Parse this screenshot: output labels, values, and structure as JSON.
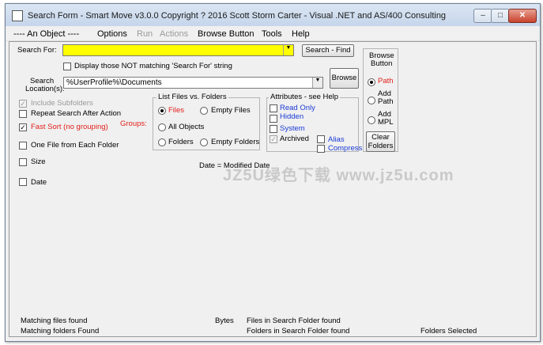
{
  "window": {
    "title": "Search Form - Smart Move v3.0.0 Copyright ? 2016 Scott Storm Carter - Visual .NET and AS/400 Consulting",
    "buttons": {
      "minimize": "–",
      "maximize": "□",
      "close": "✕"
    }
  },
  "menu": {
    "items": [
      "---- An Object ----",
      "Options",
      "Run",
      "Actions",
      "Browse Button",
      "Tools",
      "Help"
    ]
  },
  "search": {
    "search_for_label": "Search For:",
    "search_for_value": "",
    "find_button": "Search - Find",
    "display_not_matching": "Display those NOT matching 'Search For' string",
    "location_label_1": "Search",
    "location_label_2": "Location(s):",
    "location_value": "%UserProfile%\\Documents",
    "browse_button": "Browse"
  },
  "browse_group": {
    "title_1": "Browse",
    "title_2": "Button",
    "options": [
      "Path",
      "Add Path",
      "Add MPL"
    ],
    "clear_button": "Clear Folders"
  },
  "left_options": {
    "include_subfolders": "Include Subfolders",
    "repeat_search": "Repeat Search After Action",
    "fast_sort": "Fast Sort (no grouping)",
    "groups": "Groups:",
    "one_file": "One File from Each Folder",
    "size": "Size",
    "date": "Date"
  },
  "list_group": {
    "title": "List Files vs. Folders",
    "files": "Files",
    "empty_files": "Empty Files",
    "all_objects": "All Objects",
    "folders": "Folders",
    "empty_folders": "Empty Folders"
  },
  "attributes_group": {
    "title": "Attributes - see Help",
    "read_only": "Read Only",
    "hidden": "Hidden",
    "system": "System",
    "archived": "Archived",
    "alias": "Alias",
    "compress": "Compress"
  },
  "date_label": "Date = Modified Date",
  "watermark": "JZ5U绿色下载 www.jz5u.com",
  "status": {
    "matching_files": "Matching files found",
    "bytes": "Bytes",
    "files_in_folder": "Files in Search Folder found",
    "matching_folders": "Matching folders Found",
    "folders_in_folder": "Folders in Search Folder found",
    "folders_selected": "Folders Selected"
  },
  "colors": {
    "search_field_bg": "#ffff00",
    "link_blue": "#1a3ad6",
    "fast_sort_red": "#e0201c",
    "groups_red": "#e0201c"
  }
}
